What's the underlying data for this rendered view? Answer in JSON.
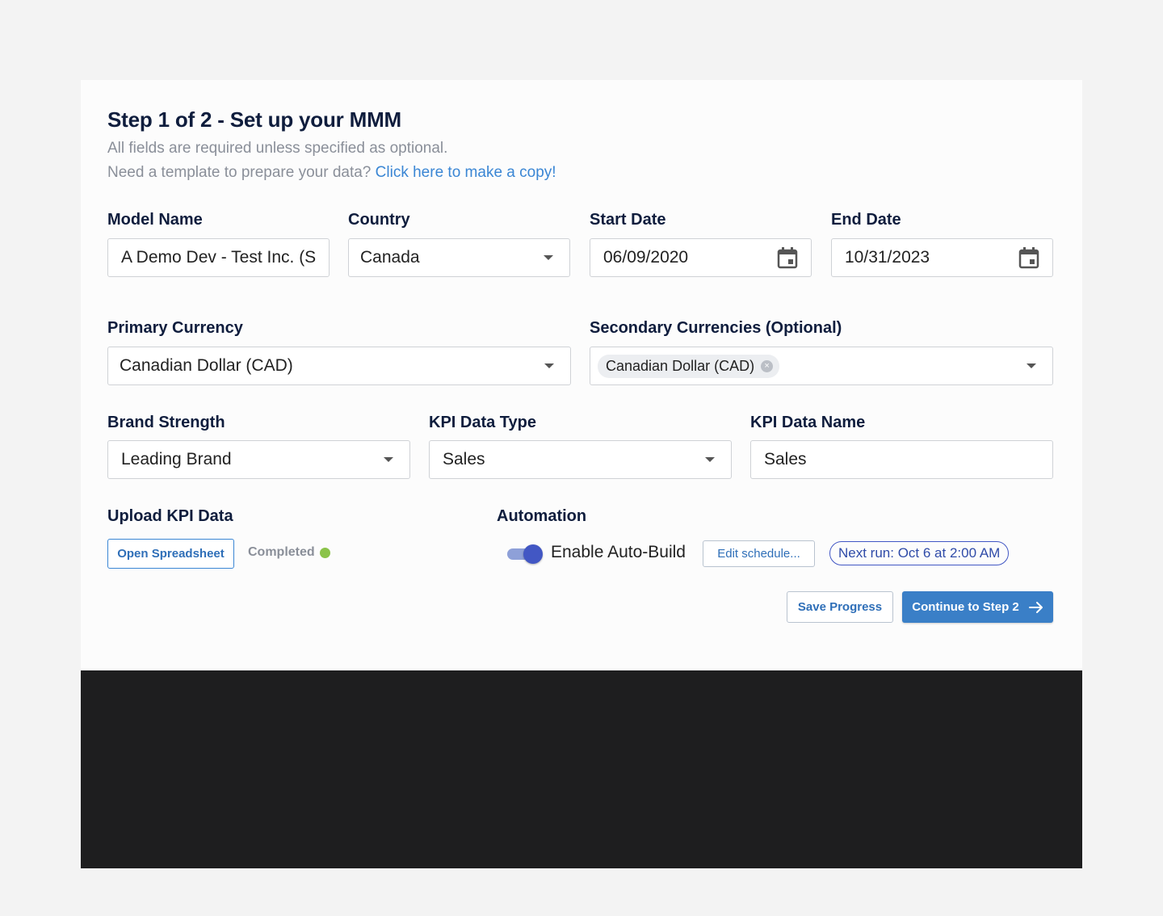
{
  "header": {
    "title": "Step 1 of 2 - Set up your MMM",
    "subtitle": "All fields are required unless specified as optional.",
    "template_prompt": "Need a template to prepare your data?",
    "template_link": "Click here to make a copy!"
  },
  "fields": {
    "model_name": {
      "label": "Model Name",
      "value": "A Demo Dev - Test Inc. (S"
    },
    "country": {
      "label": "Country",
      "value": "Canada"
    },
    "start_date": {
      "label": "Start Date",
      "value": "06/09/2020"
    },
    "end_date": {
      "label": "End Date",
      "value": "10/31/2023"
    },
    "primary_currency": {
      "label": "Primary Currency",
      "value": "Canadian Dollar (CAD)"
    },
    "secondary_currencies": {
      "label": "Secondary Currencies (Optional)",
      "chips": [
        "Canadian Dollar (CAD)"
      ]
    },
    "brand_strength": {
      "label": "Brand Strength",
      "value": "Leading Brand"
    },
    "kpi_data_type": {
      "label": "KPI Data Type",
      "value": "Sales"
    },
    "kpi_data_name": {
      "label": "KPI Data Name",
      "value": "Sales"
    }
  },
  "upload": {
    "label": "Upload KPI Data",
    "button": "Open Spreadsheet",
    "status": "Completed"
  },
  "automation": {
    "label": "Automation",
    "toggle_label": "Enable Auto-Build",
    "toggle_on": true,
    "edit_button": "Edit schedule...",
    "next_run": "Next run: Oct 6 at 2:00 AM"
  },
  "actions": {
    "save": "Save Progress",
    "continue": "Continue to Step 2"
  },
  "colors": {
    "accent": "#3a7fc7",
    "link": "#3a86d4",
    "toggle": "#4257c4",
    "success": "#8bc34a",
    "heading": "#0f1d3d"
  },
  "icons": {
    "calendar": "calendar-icon",
    "caret": "chevron-down-icon",
    "arrow": "arrow-right-icon",
    "chip_remove": "close-circle-icon",
    "status": "check-circle-icon"
  }
}
